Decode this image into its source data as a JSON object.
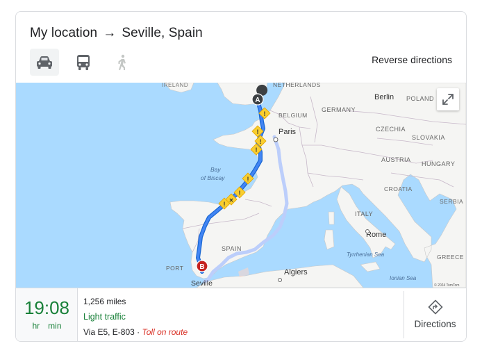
{
  "header": {
    "origin": "My location",
    "arrow": "→",
    "destination": "Seville, Spain",
    "reverse_label": "Reverse directions"
  },
  "modes": [
    {
      "name": "driving",
      "icon": "car-icon",
      "active": true
    },
    {
      "name": "transit",
      "icon": "bus-icon",
      "active": false
    },
    {
      "name": "walking",
      "icon": "walk-icon",
      "active": false
    }
  ],
  "map": {
    "labels": {
      "netherlands": "NETHERLANDS",
      "ireland": "IRELAND",
      "berlin": "Berlin",
      "poland": "POLAND",
      "belgium": "BELGIUM",
      "germany": "GERMANY",
      "paris": "Paris",
      "czechia": "CZECHIA",
      "slovakia": "SLOVAKIA",
      "austria": "AUSTRIA",
      "hungary": "HUNGARY",
      "bay": "Bay",
      "of_biscay": "of Biscay",
      "croatia": "CROATIA",
      "serbia": "SERBIA",
      "italy": "ITALY",
      "rome": "Rome",
      "spain": "SPAIN",
      "port": "PORT",
      "tyrrhenian": "Tyrrhenian Sea",
      "greece": "GREECE",
      "algiers": "Algiers",
      "ionian": "Ionian Sea",
      "seville": "Seville",
      "attribution": "© 2024 TomTom"
    },
    "markers": {
      "start": "A",
      "end": "B"
    }
  },
  "summary": {
    "time": "19:08",
    "hr_label": "hr",
    "min_label": "min",
    "distance": "1,256 miles",
    "traffic": "Light traffic",
    "via": "Via E5, E-803",
    "separator": "·",
    "toll": "Toll on route",
    "directions_label": "Directions"
  },
  "colors": {
    "route_primary": "#4285f4",
    "route_alt": "#bccefb",
    "water": "#aadaff",
    "land": "#f5f5f3",
    "traffic_green": "#188038",
    "toll_red": "#d93025"
  }
}
